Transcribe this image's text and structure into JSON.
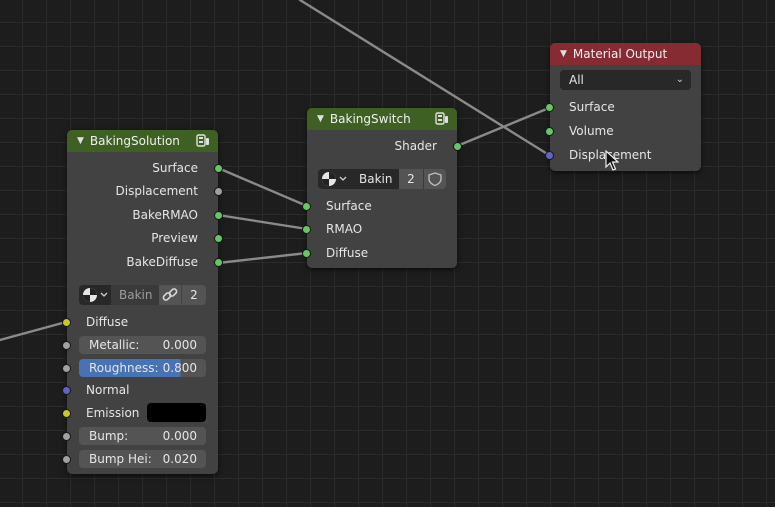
{
  "nodes": {
    "baking_solution": {
      "title": "BakingSolution",
      "outputs": [
        "Surface",
        "Displacement",
        "BakeRMAO",
        "Preview",
        "BakeDiffuse"
      ],
      "datablock": {
        "name": "Bakin",
        "users": "2"
      },
      "inputs": {
        "diffuse": "Diffuse",
        "metallic": {
          "label": "Metallic:",
          "value": "0.000"
        },
        "roughness": {
          "label": "Roughness:",
          "value": "0.800"
        },
        "normal": "Normal",
        "emission": "Emission",
        "bump": {
          "label": "Bump:",
          "value": "0.000"
        },
        "bump_height": {
          "label": "Bump Hei:",
          "value": "0.020"
        }
      }
    },
    "baking_switch": {
      "title": "BakingSwitch",
      "output": "Shader",
      "datablock": {
        "name": "Bakin",
        "users": "2"
      },
      "inputs": [
        "Surface",
        "RMAO",
        "Diffuse"
      ]
    },
    "material_output": {
      "title": "Material Output",
      "target": "All",
      "inputs": [
        "Surface",
        "Volume",
        "Displacement"
      ]
    }
  },
  "colors": {
    "shader_socket": "#63c763",
    "color_socket": "#c7c729",
    "float_socket": "#a1a1a1",
    "vector_socket": "#6363c7",
    "group_header": "#3f6023",
    "output_header": "#872b33",
    "selected_field": "#4772b3"
  },
  "icons": {
    "collapse": "triangle-down-icon",
    "group": "node-group-icon",
    "material": "material-sphere-icon",
    "fake_user": "shield-icon",
    "link": "chain-link-icon"
  }
}
